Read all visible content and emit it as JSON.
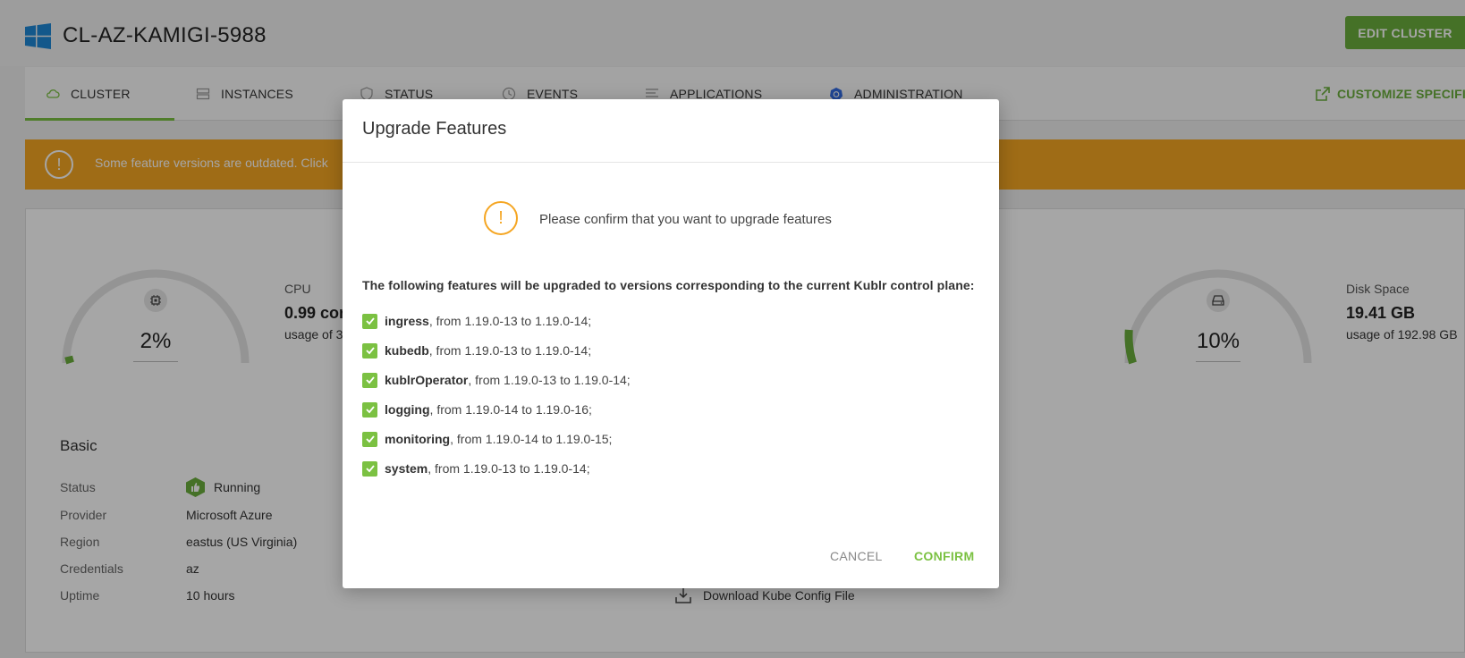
{
  "header": {
    "title": "CL-AZ-KAMIGI-5988",
    "edit_button": "EDIT CLUSTER",
    "logo_icon": "windows-logo-icon"
  },
  "tabs": [
    {
      "label": "CLUSTER",
      "icon": "cloud-icon"
    },
    {
      "label": "INSTANCES",
      "icon": "server-icon"
    },
    {
      "label": "STATUS",
      "icon": "shield-icon"
    },
    {
      "label": "EVENTS",
      "icon": "clock-icon"
    },
    {
      "label": "APPLICATIONS",
      "icon": "list-icon"
    },
    {
      "label": "ADMINISTRATION",
      "icon": "kubernetes-icon"
    }
  ],
  "customize_link": "CUSTOMIZE SPECIFICATIC",
  "banner": {
    "text": "Some feature versions are outdated. Click",
    "color": "#f5a623"
  },
  "metrics": {
    "cpu": {
      "label": "CPU",
      "value": "0.99 cor",
      "usage": "usage of 3",
      "percent": "2%",
      "fraction": 0.02
    },
    "disk": {
      "label": "Disk Space",
      "value": "19.41 GB",
      "usage": "usage of 192.98 GB",
      "percent": "10%",
      "fraction": 0.1
    }
  },
  "basic": {
    "title": "Basic",
    "rows": [
      {
        "key": "Status",
        "value": "Running"
      },
      {
        "key": "Provider",
        "value": "Microsoft Azure"
      },
      {
        "key": "Region",
        "value": "eastus (US Virginia)"
      },
      {
        "key": "Credentials",
        "value": "az"
      },
      {
        "key": "Uptime",
        "value": "10 hours"
      }
    ]
  },
  "download_link": "Download Kube Config File",
  "modal": {
    "title": "Upgrade Features",
    "confirm_text": "Please confirm that you want to upgrade features",
    "intro": "The following features will be upgraded to versions corresponding to the current Kublr control plane:",
    "features": [
      {
        "name": "ingress",
        "detail": ", from 1.19.0-13 to 1.19.0-14;"
      },
      {
        "name": "kubedb",
        "detail": ", from 1.19.0-13 to 1.19.0-14;"
      },
      {
        "name": "kublrOperator",
        "detail": ", from 1.19.0-13 to 1.19.0-14;"
      },
      {
        "name": "logging",
        "detail": ", from 1.19.0-14 to 1.19.0-16;"
      },
      {
        "name": "monitoring",
        "detail": ", from 1.19.0-14 to 1.19.0-15;"
      },
      {
        "name": "system",
        "detail": ", from 1.19.0-13 to 1.19.0-14;"
      }
    ],
    "cancel_label": "CANCEL",
    "confirm_label": "CONFIRM"
  },
  "colors": {
    "accent": "#7bc142",
    "edit_button": "#6aae3c",
    "warning": "#f5a623"
  }
}
